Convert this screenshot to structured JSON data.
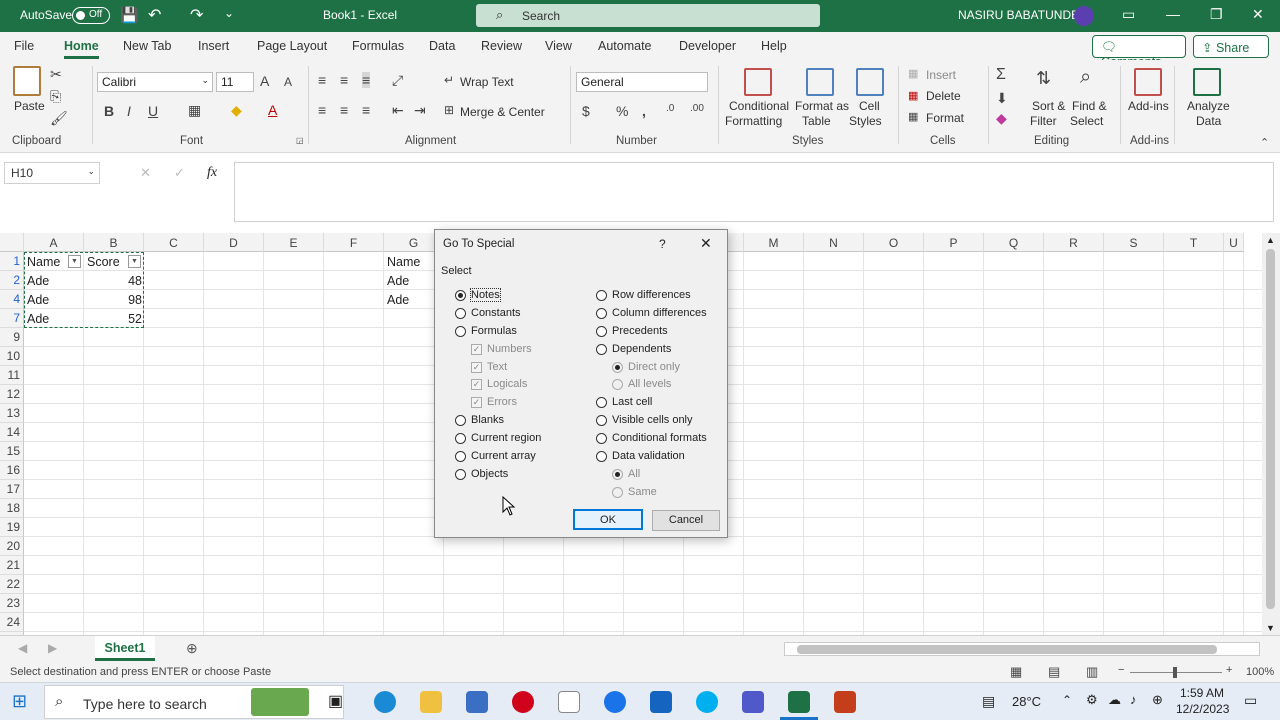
{
  "titlebar": {
    "autosave": "AutoSave",
    "toggle": "Off",
    "title": "Book1 - Excel",
    "search": "Search",
    "user": "NASIRU BABATUNDE"
  },
  "tabs": [
    "File",
    "Home",
    "New Tab",
    "Insert",
    "Page Layout",
    "Formulas",
    "Data",
    "Review",
    "View",
    "Automate",
    "Developer",
    "Help"
  ],
  "tab_active": "Home",
  "actions": {
    "comments": "Comments",
    "share": "Share"
  },
  "ribbon": {
    "clipboard": {
      "paste": "Paste",
      "group": "Clipboard"
    },
    "font": {
      "name": "Calibri",
      "size": "11",
      "group": "Font"
    },
    "alignment": {
      "wrap": "Wrap Text",
      "merge": "Merge & Center",
      "group": "Alignment"
    },
    "number": {
      "format": "General",
      "group": "Number"
    },
    "styles": {
      "cond1": "Conditional",
      "cond2": "Formatting",
      "fmt1": "Format as",
      "fmt2": "Table",
      "cell1": "Cell",
      "cell2": "Styles",
      "group": "Styles"
    },
    "cells": {
      "insert": "Insert",
      "delete": "Delete",
      "format": "Format",
      "group": "Cells"
    },
    "editing": {
      "sort1": "Sort &",
      "sort2": "Filter",
      "find1": "Find &",
      "find2": "Select",
      "group": "Editing"
    },
    "addins": {
      "label": "Add-ins",
      "group": "Add-ins"
    },
    "analyze": {
      "l1": "Analyze",
      "l2": "Data"
    }
  },
  "formula_bar": {
    "namebox": "H10",
    "fx": "fx",
    "value": ""
  },
  "columns": [
    "A",
    "B",
    "C",
    "D",
    "E",
    "F",
    "G",
    "H",
    "I",
    "J",
    "K",
    "L",
    "M",
    "N",
    "O",
    "P",
    "Q",
    "R",
    "S",
    "T",
    "U"
  ],
  "rows": [
    "1",
    "2",
    "4",
    "7",
    "9",
    "10",
    "11",
    "12",
    "13",
    "14",
    "15",
    "16",
    "17",
    "18",
    "19",
    "20",
    "21",
    "22",
    "23",
    "24",
    "25"
  ],
  "cells": {
    "a1": "Name",
    "b1": "Score",
    "a2": "Ade",
    "b2": "48",
    "a4": "Ade",
    "b4": "98",
    "a7": "Ade",
    "b7": "52",
    "g1": "Name",
    "g2": "Ade",
    "g4": "Ade"
  },
  "sheet": {
    "name": "Sheet1"
  },
  "status": {
    "message": "Select destination and press ENTER or choose Paste",
    "zoom": "100%"
  },
  "taskbar": {
    "search": "Type here to search",
    "temp": "28°C",
    "time": "1:59 AM",
    "date": "12/2/2023"
  },
  "dialog": {
    "title": "Go To Special",
    "help": "?",
    "section": "Select",
    "left": [
      "Notes",
      "Constants",
      "Formulas",
      "Numbers",
      "Text",
      "Logicals",
      "Errors",
      "Blanks",
      "Current region",
      "Current array",
      "Objects"
    ],
    "right": [
      "Row differences",
      "Column differences",
      "Precedents",
      "Dependents",
      "Direct only",
      "All levels",
      "Last cell",
      "Visible cells only",
      "Conditional formats",
      "Data validation",
      "All",
      "Same"
    ],
    "ok": "OK",
    "cancel": "Cancel"
  }
}
